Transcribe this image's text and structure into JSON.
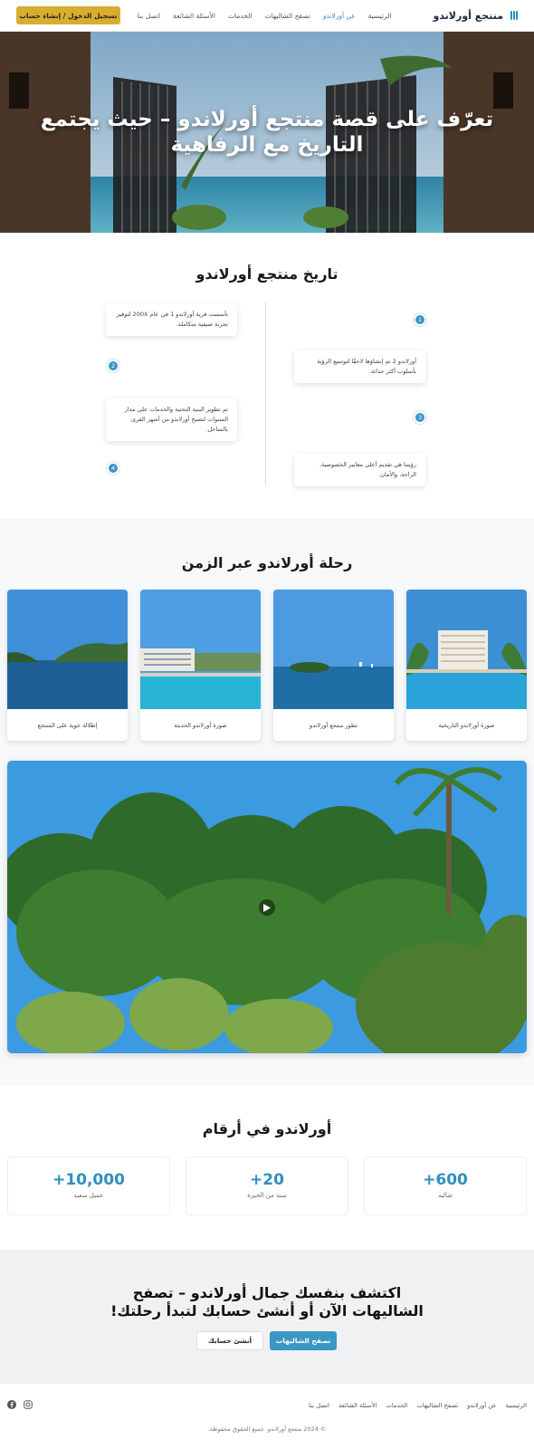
{
  "nav": {
    "brand": "منتجع أورلاندو",
    "items": [
      {
        "label": "الرئيسية",
        "active": false
      },
      {
        "label": "عن أورلاندو",
        "active": true
      },
      {
        "label": "تصفح الشاليهات",
        "active": false
      },
      {
        "label": "الخدمات",
        "active": false
      },
      {
        "label": "الأسئلة الشائعة",
        "active": false
      },
      {
        "label": "اتصل بنا",
        "active": false
      }
    ],
    "cta": "تسجيل الدخول / إنشاء حساب"
  },
  "hero": {
    "title": "تعرّف على قصة منتجع أورلاندو – حيث يجتمع التاريخ مع الرفاهية"
  },
  "history": {
    "title": "تاريخ منتجع أورلاندو",
    "items": [
      {
        "num": "1",
        "text": "تأسست قرية أورلاندو 1 في عام 200X لتوفير تجربة صيفية متكاملة."
      },
      {
        "num": "2",
        "text": "أورلاندو 2 تم إنشاؤها لاحقًا لتوسيع الرؤية بأسلوب أكثر حداثة."
      },
      {
        "num": "3",
        "text": "تم تطوير البنية التحتية والخدمات على مدار السنوات لتصبح أورلاندو من أشهر القرى بالساحل."
      },
      {
        "num": "4",
        "text": "رؤيتنا هي تقديم أعلى معايير الخصوصية، الراحة، والأمان."
      }
    ]
  },
  "journey": {
    "title": "رحلة أورلاندو عبر الزمن",
    "cards": [
      {
        "caption": "صورة أورلاندو التاريخية"
      },
      {
        "caption": "تطور منتجع أورلاندو"
      },
      {
        "caption": "صورة أورلاندو الحديثة"
      },
      {
        "caption": "إطلالة جوية على المنتجع"
      }
    ]
  },
  "stats": {
    "title": "أورلاندو في أرقام",
    "items": [
      {
        "num": "600+",
        "label": "شاليه"
      },
      {
        "num": "20+",
        "label": "سنة من الخبرة"
      },
      {
        "num": "10,000+",
        "label": "عميل سعيد"
      }
    ]
  },
  "cta": {
    "title_line1": "اكتشف بنفسك جمال أورلاندو – تصفح",
    "title_line2": "الشاليهات الآن أو أنشئ حسابك لتبدأ رحلتك!",
    "primary": "تصفح الشاليهات",
    "secondary": "أنشئ حسابك"
  },
  "footer": {
    "links": [
      "الرئيسية",
      "عن أورلاندو",
      "تصفح الشاليهات",
      "الخدمات",
      "الأسئلة الشائعة",
      "اتصل بنا"
    ],
    "social": [
      "facebook-icon",
      "instagram-icon"
    ],
    "copyright": "© 2024 منتجع أورلاندو. جميع الحقوق محفوظة."
  },
  "colors": {
    "accent": "#3a97c4",
    "gold": "#d9ad2f"
  }
}
